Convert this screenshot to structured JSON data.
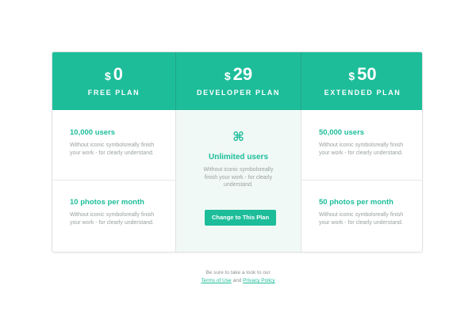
{
  "plans": [
    {
      "currency": "$",
      "price": "0",
      "name": "FREE PLAN",
      "features": [
        {
          "title": "10,000 users",
          "desc": "Without  iconic symbolsreally finish your work - for clearly understand."
        },
        {
          "title": "10 photos per month",
          "desc": "Without  iconic symbolsreally finish your work - for clearly understand."
        }
      ]
    },
    {
      "currency": "$",
      "price": "29",
      "name": "DEVELOPER PLAN",
      "icon": "command-icon",
      "icon_glyph": "⌘",
      "feature": {
        "title": "Unlimited users",
        "desc": "Without  iconic symbolsreally finish your work - for clearly understand."
      },
      "cta_label": "Change to This Plan"
    },
    {
      "currency": "$",
      "price": "50",
      "name": "EXTENDED PLAN",
      "features": [
        {
          "title": "50,000 users",
          "desc": "Without  iconic symbolsreally finish your work - for clearly understand."
        },
        {
          "title": "50 photos per month",
          "desc": "Without  iconic symbolsreally finish your work - for clearly understand."
        }
      ]
    }
  ],
  "footer": {
    "text": "Be sure to take a look to our",
    "terms_label": "Terms of Use",
    "and": "and",
    "privacy_label": "Privacy Policy"
  },
  "colors": {
    "accent": "#1dbd9a",
    "highlight_bg": "#f1f9f7",
    "muted_text": "#9aa1a0"
  }
}
